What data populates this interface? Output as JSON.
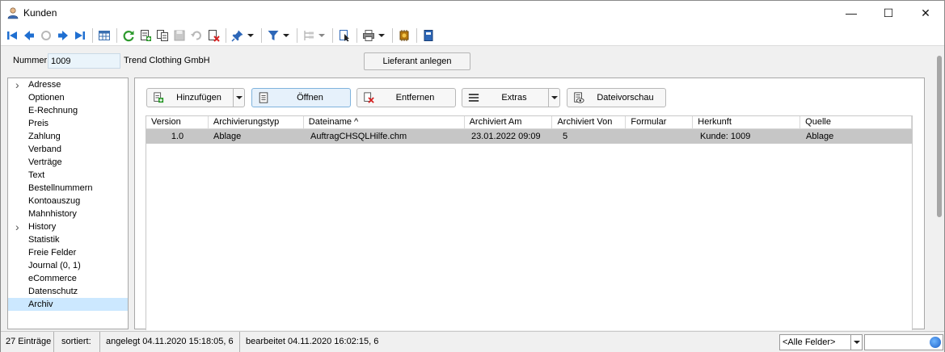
{
  "window": {
    "title": "Kunden"
  },
  "header": {
    "nummer_label": "Nummer",
    "nummer_value": "1009",
    "company": "Trend Clothing GmbH",
    "lieferant_button": "Lieferant anlegen"
  },
  "nav": {
    "items": [
      {
        "label": "Adresse",
        "expandable": true
      },
      {
        "label": "Optionen"
      },
      {
        "label": "E-Rechnung"
      },
      {
        "label": "Preis"
      },
      {
        "label": "Zahlung"
      },
      {
        "label": "Verband"
      },
      {
        "label": "Verträge"
      },
      {
        "label": "Text"
      },
      {
        "label": "Bestellnummern"
      },
      {
        "label": "Kontoauszug"
      },
      {
        "label": "Mahnhistory"
      },
      {
        "label": "History",
        "expandable": true
      },
      {
        "label": "Statistik"
      },
      {
        "label": "Freie Felder"
      },
      {
        "label": "Journal (0, 1)"
      },
      {
        "label": "eCommerce"
      },
      {
        "label": "Datenschutz"
      },
      {
        "label": "Archiv",
        "selected": true
      }
    ]
  },
  "actions": {
    "add": "Hinzufügen",
    "open": "Öffnen",
    "remove": "Entfernen",
    "extras": "Extras",
    "preview": "Dateivorschau"
  },
  "grid": {
    "columns": [
      "Version",
      "Archivierungstyp",
      "Dateiname ^",
      "Archiviert Am",
      "Archiviert Von",
      "Formular",
      "Herkunft",
      "Quelle"
    ],
    "rows": [
      [
        "1.0",
        "Ablage",
        "AuftragCHSQLHilfe.chm",
        "23.01.2022 09:09",
        "5",
        "",
        "Kunde: 1009",
        "Ablage"
      ]
    ]
  },
  "status": {
    "count": "27 Einträge",
    "sorted": "sortiert:",
    "created": "angelegt 04.11.2020 15:18:05,  6",
    "edited": "bearbeitet 04.11.2020 16:02:15,  6",
    "field_select": "<Alle Felder>"
  }
}
